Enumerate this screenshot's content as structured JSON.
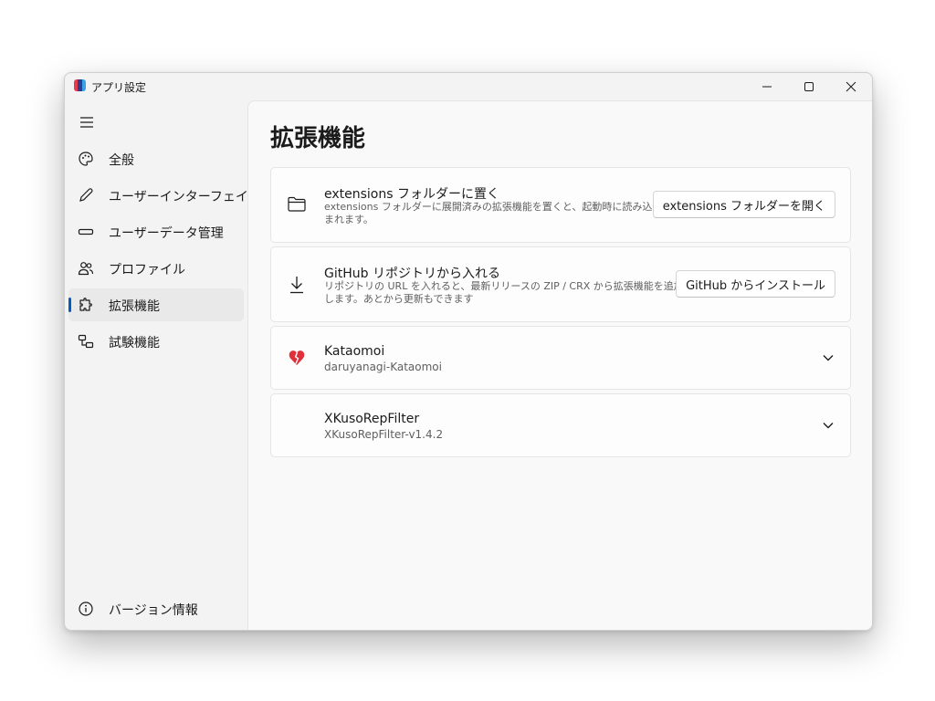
{
  "window": {
    "title": "アプリ設定",
    "controls": {
      "minimize": "minimize-icon",
      "maximize": "maximize-icon",
      "close": "close-icon"
    }
  },
  "sidebar": {
    "menu_icon": "hamburger-menu-icon",
    "items": [
      {
        "label": "全般",
        "icon": "palette-icon",
        "selected": false
      },
      {
        "label": "ユーザーインターフェイス",
        "icon": "pen-icon",
        "selected": false
      },
      {
        "label": "ユーザーデータ管理",
        "icon": "storage-icon",
        "selected": false
      },
      {
        "label": "プロファイル",
        "icon": "people-icon",
        "selected": false
      },
      {
        "label": "拡張機能",
        "icon": "puzzle-icon",
        "selected": true
      },
      {
        "label": "試験機能",
        "icon": "flask-icon",
        "selected": false
      }
    ],
    "footer": {
      "label": "バージョン情報",
      "icon": "info-icon"
    }
  },
  "main": {
    "title": "拡張機能",
    "cards": [
      {
        "icon": "folder-icon",
        "title": "extensions フォルダーに置く",
        "description_line1": "extensions フォルダーに展開済みの拡張機能を置くと、起動時に読み込",
        "description_line2": "まれます。",
        "button": "extensions フォルダーを開く"
      },
      {
        "icon": "download-icon",
        "title": "GitHub リポジトリから入れる",
        "description_line1": "リポジトリの URL を入れると、最新リリースの ZIP / CRX から拡張機能を追加",
        "description_line2": "します。あとから更新もできます",
        "button": "GitHub からインストール"
      }
    ],
    "extensions": [
      {
        "icon": "broken-heart-icon",
        "name": "Kataomoi",
        "id": "daruyanagi-Kataomoi",
        "expand_icon": "chevron-down-icon"
      },
      {
        "icon": "",
        "name": "XKusoRepFilter",
        "id": "XKusoRepFilter-v1.4.2",
        "expand_icon": "chevron-down-icon"
      }
    ]
  },
  "colors": {
    "accent": "#005fb8",
    "heart": "#e0303a",
    "sidebar_bg": "#f3f3f3",
    "content_bg": "#f9f9f9"
  }
}
